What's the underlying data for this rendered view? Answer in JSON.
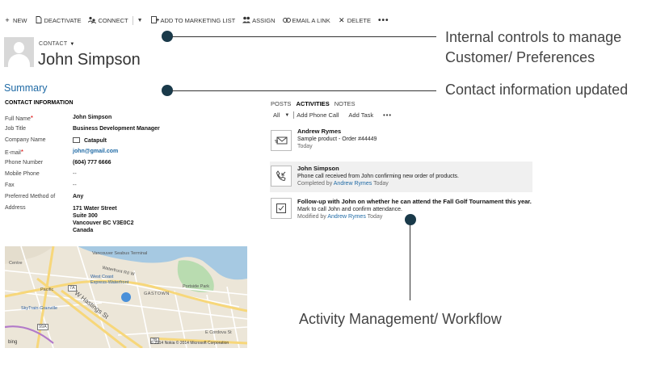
{
  "toolbar": {
    "new": "NEW",
    "deactivate": "DEACTIVATE",
    "connect": "CONNECT",
    "add_to_marketing_list": "ADD TO MARKETING LIST",
    "assign": "ASSIGN",
    "email_a_link": "EMAIL A LINK",
    "delete": "DELETE",
    "more": "•••"
  },
  "header": {
    "entity_type": "CONTACT",
    "name": "John Simpson"
  },
  "summary": {
    "title": "Summary",
    "section": "CONTACT INFORMATION",
    "fields": [
      {
        "label": "Full Name",
        "value": "John Simpson",
        "required": true,
        "style": "bold"
      },
      {
        "label": "Job Title",
        "value": "Business Development Manager",
        "style": "bold"
      },
      {
        "label": "Company Name",
        "value": "Catapult",
        "style": "company"
      },
      {
        "label": "E-mail",
        "value": "john@gmail.com",
        "required": true,
        "style": "link"
      },
      {
        "label": "Phone Number",
        "value": "(604) 777 6666",
        "style": "bold"
      },
      {
        "label": "Mobile Phone",
        "value": "--",
        "style": "plain"
      },
      {
        "label": "Fax",
        "value": "--",
        "style": "plain"
      },
      {
        "label": "Preferred Method of",
        "value": "Any",
        "style": "bold"
      }
    ],
    "address_label": "Address",
    "address_lines": [
      "171 Water Street",
      "Suite 300",
      "Vancouver BC V3E0C2",
      "Canada"
    ]
  },
  "map": {
    "labels": {
      "terminal": "Vancouver Seabus Terminal",
      "waterfront_rd": "Waterfront Rd W",
      "west_coast": "West Coast",
      "express": "Express-Waterfront",
      "centre": "Centre",
      "pacific": "Pacific",
      "gastown": "GASTOWN",
      "portside": "Portside Park",
      "skytrain": "SkyTrain-Granville",
      "w_hastings": "W Hastings St",
      "cordova": "E Cordova St",
      "hwy7a": "7A",
      "hwy99a": "99A",
      "hwy7b": "7B",
      "bing": "bing",
      "credit": "© 2014 Nokia  © 2014 Microsoft Corporation"
    }
  },
  "social": {
    "tabs": [
      "POSTS",
      "ACTIVITIES",
      "NOTES"
    ],
    "active_tab": "ACTIVITIES",
    "filter": "All",
    "add_phone_call": "Add Phone Call",
    "add_task": "Add Task",
    "more": "•••",
    "activities": [
      {
        "title": "Andrew Rymes",
        "line": "Sample product - Order #44449",
        "meta_prefix": "Today",
        "who": "",
        "when": "",
        "icon": "email-icon"
      },
      {
        "title": "John Simpson",
        "line": "Phone call received from John confirming new order of products.",
        "meta_prefix": "Completed by",
        "who": "Andrew Rymes",
        "when": "Today",
        "icon": "phone-call-icon"
      },
      {
        "title": "Follow-up with John on whether he can attend the Fall Golf Tournament this year.",
        "line": "Mark to call John and confirm attendance.",
        "meta_prefix": "Modified by",
        "who": "Andrew Rymes",
        "when": "Today",
        "icon": "task-checkbox-icon"
      }
    ]
  },
  "annotations": {
    "top_line1": "Internal controls to manage",
    "top_line2": "Customer/ Preferences",
    "middle": "Contact information updated",
    "bottom": "Activity Management/ Workflow"
  },
  "colors": {
    "link": "#1f6aa5",
    "callout_dot": "#1a3a4a"
  }
}
